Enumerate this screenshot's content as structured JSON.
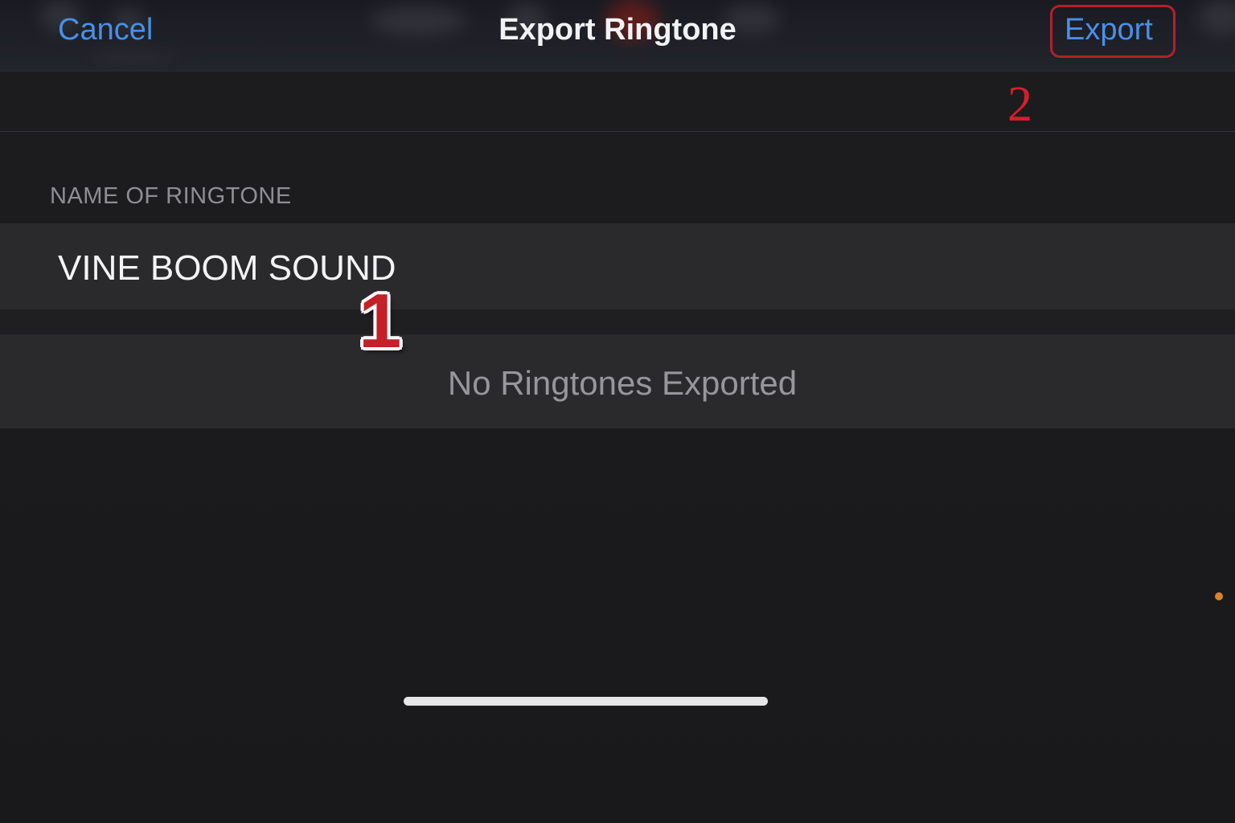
{
  "nav": {
    "cancel_label": "Cancel",
    "title": "Export Ringtone",
    "export_label": "Export"
  },
  "annotations": {
    "step1": "1",
    "step2": "2"
  },
  "form": {
    "section_header": "NAME OF RINGTONE",
    "ringtone_name": "VINE BOOM SOUND"
  },
  "list": {
    "empty_message": "No Ringtones Exported"
  },
  "colors": {
    "accent": "#4a8fe7",
    "annotation_red": "#c4202a",
    "recording_dot": "#d9822b",
    "background": "#1b1b1d"
  }
}
